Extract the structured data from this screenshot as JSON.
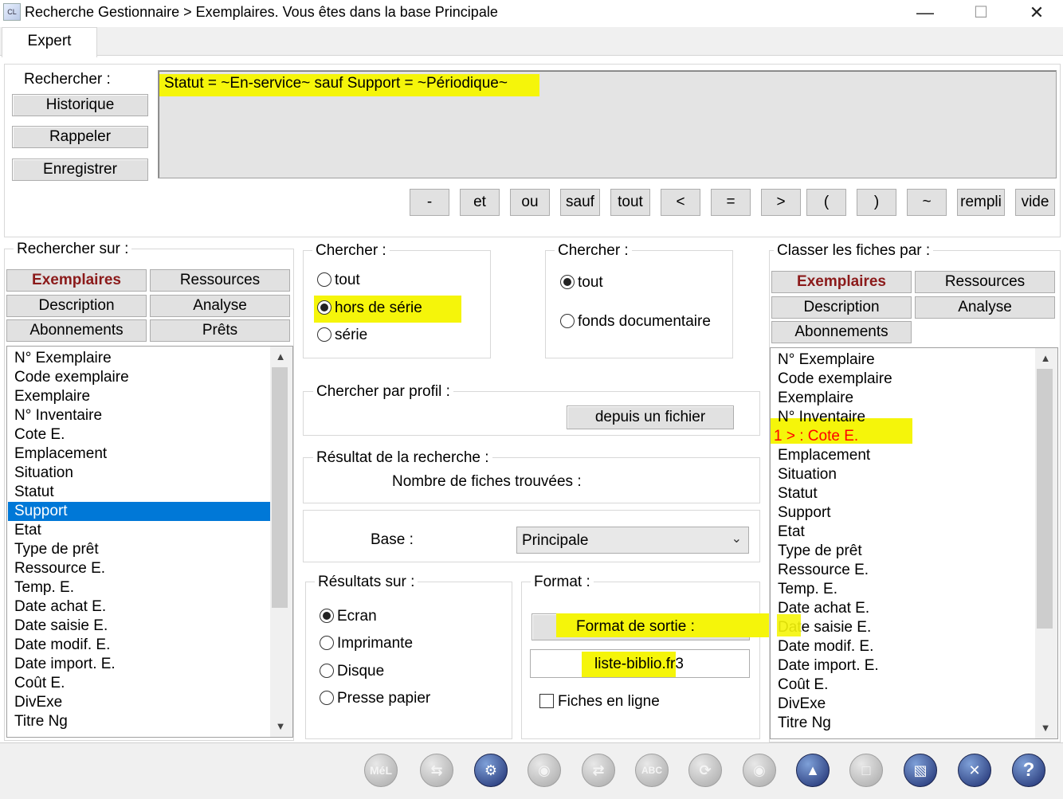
{
  "window": {
    "title": "Recherche Gestionnaire > Exemplaires.  Vous êtes dans la base Principale",
    "icon_label": "CL",
    "minimize": "—",
    "maximize": "☐",
    "close": "✕"
  },
  "tabs": {
    "expert": "Expert"
  },
  "search": {
    "label": "Rechercher :",
    "historique": "Historique",
    "rappeler": "Rappeler",
    "enregistrer": "Enregistrer",
    "query": "Statut = ~En-service~ sauf Support = ~Périodique~",
    "operators": [
      "-",
      "et",
      "ou",
      "sauf",
      "tout",
      "<",
      "=",
      ">",
      "(",
      ")",
      "~",
      "rempli",
      "vide"
    ]
  },
  "search_on": {
    "title": "Rechercher sur :",
    "categories": [
      "Exemplaires",
      "Ressources",
      "Description",
      "Analyse",
      "Abonnements",
      "Prêts"
    ],
    "fields": [
      "N° Exemplaire",
      "Code exemplaire",
      "Exemplaire",
      "N° Inventaire",
      "Cote E.",
      "Emplacement",
      "Situation",
      "Statut",
      "Support",
      "Etat",
      "Type de prêt",
      "Ressource E.",
      "Temp. E.",
      "Date achat E.",
      "Date saisie E.",
      "Date modif. E.",
      "Date import. E.",
      "Coût E.",
      "DivExe",
      "Titre Ng"
    ],
    "selected_index": 8
  },
  "chercher1": {
    "title": "Chercher :",
    "options": [
      "tout",
      "hors de série",
      "série"
    ],
    "selected": 1
  },
  "chercher2": {
    "title": "Chercher :",
    "options": [
      "tout",
      "fonds documentaire"
    ],
    "selected": 0
  },
  "profil": {
    "title": "Chercher par profil :",
    "button": "depuis un fichier"
  },
  "resultat": {
    "title": "Résultat de la recherche :",
    "count_label": "Nombre de fiches trouvées :"
  },
  "base": {
    "label": "Base :",
    "value": "Principale"
  },
  "resultats_sur": {
    "title": "Résultats sur :",
    "options": [
      "Ecran",
      "Imprimante",
      "Disque",
      "Presse papier"
    ],
    "selected": 0
  },
  "format": {
    "title": "Format :",
    "button": "Format de sortie :",
    "value": "liste-biblio.fr3",
    "online_label": "Fiches en ligne"
  },
  "sort_by": {
    "title": "Classer les fiches par :",
    "categories": [
      "Exemplaires",
      "Ressources",
      "Description",
      "Analyse",
      "Abonnements"
    ],
    "fields": [
      "N° Exemplaire",
      "Code exemplaire",
      "Exemplaire",
      "N° Inventaire",
      "1 > :  Cote E.",
      "Emplacement",
      "Situation",
      "Statut",
      "Support",
      "Etat",
      "Type de prêt",
      "Ressource E.",
      "Temp. E.",
      "Date achat E.",
      "Date saisie E.",
      "Date modif. E.",
      "Date import. E.",
      "Coût E.",
      "DivExe",
      "Titre Ng"
    ],
    "highlighted_index": 4,
    "highlight_color": "#ff0000"
  },
  "toolbar": {
    "mel_label": "MéL",
    "items": [
      "mel-icon",
      "refresh-arrows-icon",
      "gear-icon",
      "eye-icon",
      "shuffle-icon",
      "abc-icon",
      "reload-icon",
      "pot-icon",
      "pot-export-icon",
      "trash-icon",
      "book-icon",
      "close-icon",
      "help-icon"
    ]
  },
  "colors": {
    "highlight": "#f5f50a",
    "selection": "#0078d7",
    "active_category": "#8b1a1a"
  }
}
